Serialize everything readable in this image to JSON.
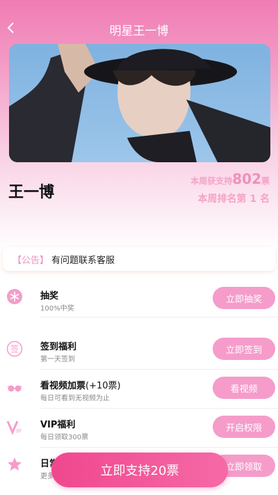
{
  "header": {
    "title": "明星王一博"
  },
  "star": {
    "name": "王一博",
    "weekly_prefix": "本周获支持",
    "weekly_votes": "802",
    "weekly_suffix": "票",
    "rank_text": "本周排名第 1 名"
  },
  "notice": {
    "tag": "【公告】",
    "message": "有问题联系客服"
  },
  "tasks": [
    {
      "title": "抽奖",
      "subtitle": "100%中奖",
      "button": "立即抽奖",
      "icon": "snowflake-icon"
    },
    {
      "title": "签到福利",
      "subtitle": "第一天签到",
      "button": "立即签到",
      "icon": "sign-in-icon"
    },
    {
      "title": "看视频加票",
      "title_extra": "(+10票)",
      "subtitle": "每日可看到无视频为止",
      "button": "看视频",
      "icon": "glasses-icon"
    },
    {
      "title": "VIP福利",
      "subtitle": "每日领取300票",
      "button": "开启权限",
      "icon": "vip-icon"
    },
    {
      "title": "日常",
      "subtitle": "更多",
      "button": "立即领取",
      "icon": "star-icon"
    }
  ],
  "support_button": "立即支持20票",
  "colors": {
    "accent": "#f59ccb",
    "brand": "#f0478f",
    "header": "#f07cb4"
  }
}
